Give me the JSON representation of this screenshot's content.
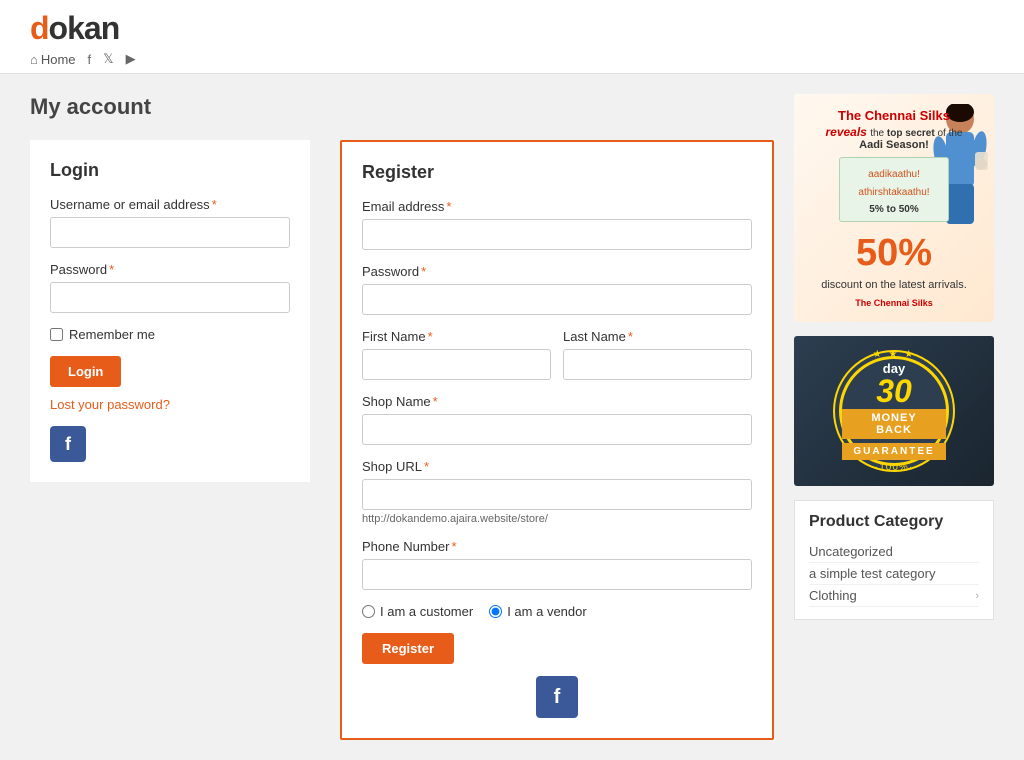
{
  "header": {
    "logo": "dokan",
    "logo_d": "d",
    "nav": {
      "home": "Home",
      "facebook_icon": "f",
      "twitter_icon": "t",
      "youtube_icon": "▶"
    }
  },
  "page": {
    "title": "My account"
  },
  "login": {
    "title": "Login",
    "username_label": "Username or email address",
    "password_label": "Password",
    "remember_label": "Remember me",
    "login_button": "Login",
    "lost_password": "Lost your password?",
    "facebook_label": "f"
  },
  "register": {
    "title": "Register",
    "email_label": "Email address",
    "password_label": "Password",
    "first_name_label": "First Name",
    "last_name_label": "Last Name",
    "shop_name_label": "Shop Name",
    "shop_url_label": "Shop URL",
    "shop_url_hint": "http://dokandemo.ajaira.website/store/",
    "phone_label": "Phone Number",
    "customer_radio": "I am a customer",
    "vendor_radio": "I am a vendor",
    "register_button": "Register",
    "facebook_label": "f"
  },
  "sidebar": {
    "banner_top": "The Chennai Silks",
    "banner_reveals": "reveals",
    "banner_secret": "the top secret of the",
    "banner_season": "Aadi Season!",
    "banner_promo1": "aadikaathu!",
    "banner_promo2": "athirshtakaathu!",
    "banner_discount": "5% to 50%",
    "banner_50": "50%",
    "banner_discount_text": "discount on the latest arrivals.",
    "banner_logo": "The Chennai Silks",
    "guarantee_30": "30",
    "guarantee_day": "day",
    "guarantee_money": "MONEY BACK",
    "guarantee_label": "GUARANTEE",
    "guarantee_100": "·100%·",
    "product_category_title": "Product Category",
    "categories": [
      {
        "name": "Uncategorized",
        "has_children": false
      },
      {
        "name": "a simple test category",
        "has_children": false
      },
      {
        "name": "Clothing",
        "has_children": true
      }
    ]
  }
}
